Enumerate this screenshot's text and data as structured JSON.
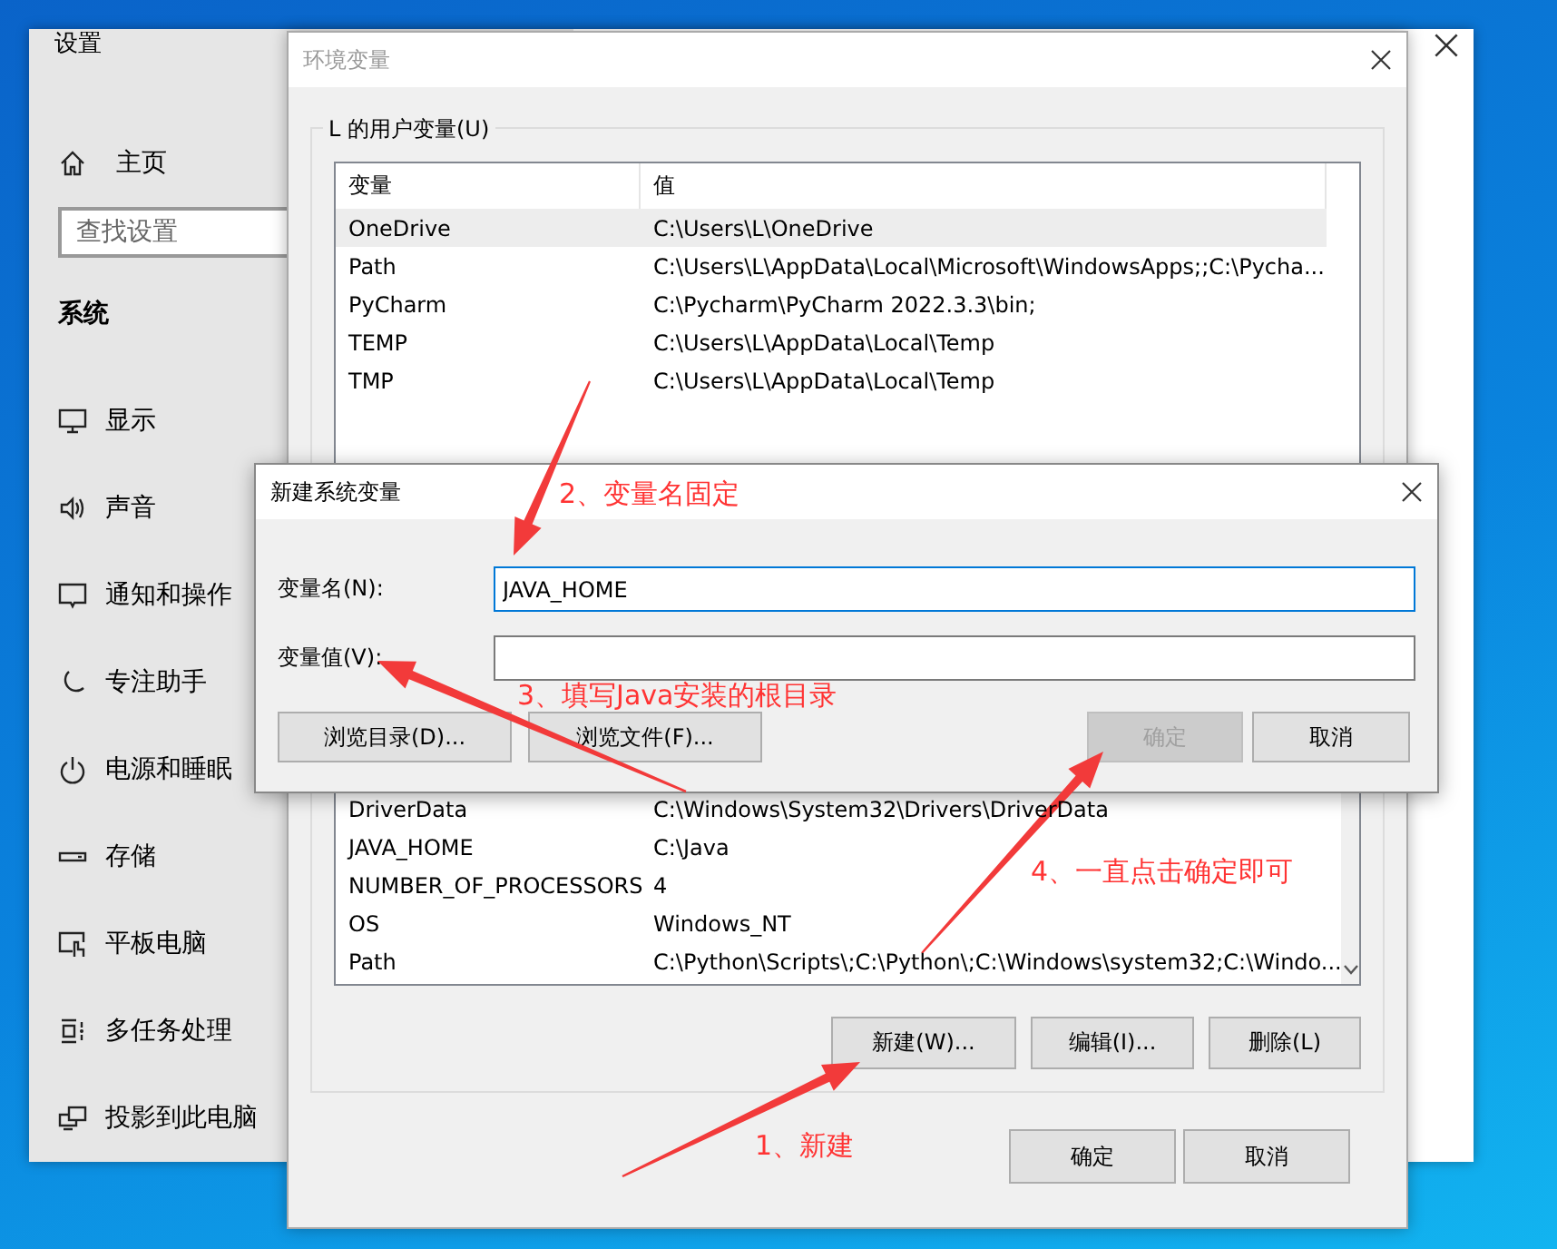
{
  "settings": {
    "title": "设置",
    "home": "主页",
    "search": {
      "placeholder": "查找设置"
    },
    "section": "系统",
    "nav": [
      {
        "label": "显示"
      },
      {
        "label": "声音"
      },
      {
        "label": "通知和操作"
      },
      {
        "label": "专注助手"
      },
      {
        "label": "电源和睡眠"
      },
      {
        "label": "存储"
      },
      {
        "label": "平板电脑"
      },
      {
        "label": "多任务处理"
      },
      {
        "label": "投影到此电脑"
      }
    ]
  },
  "env_dialog": {
    "title": "环境变量",
    "user_group": "L 的用户变量(U)",
    "user_columns": [
      "变量",
      "值"
    ],
    "user_rows": [
      {
        "name": "OneDrive",
        "value": "C:\\Users\\L\\OneDrive",
        "selected": true
      },
      {
        "name": "Path",
        "value": "C:\\Users\\L\\AppData\\Local\\Microsoft\\WindowsApps;;C:\\Pycha...",
        "selected": false
      },
      {
        "name": "PyCharm",
        "value": "C:\\Pycharm\\PyCharm 2022.3.3\\bin;",
        "selected": false
      },
      {
        "name": "TEMP",
        "value": "C:\\Users\\L\\AppData\\Local\\Temp",
        "selected": false
      },
      {
        "name": "TMP",
        "value": "C:\\Users\\L\\AppData\\Local\\Temp",
        "selected": false
      }
    ],
    "system_rows": [
      {
        "name": "DriverData",
        "value": "C:\\Windows\\System32\\Drivers\\DriverData",
        "selected": false
      },
      {
        "name": "JAVA_HOME",
        "value": "C:\\Java",
        "selected": false
      },
      {
        "name": "NUMBER_OF_PROCESSORS",
        "value": "4",
        "selected": false
      },
      {
        "name": "OS",
        "value": "Windows_NT",
        "selected": false
      },
      {
        "name": "Path",
        "value": "C:\\Python\\Scripts\\;C:\\Python\\;C:\\Windows\\system32;C:\\Windo...",
        "selected": false
      }
    ],
    "system_buttons": [
      "新建(W)...",
      "编辑(I)...",
      "删除(L)"
    ],
    "buttons": [
      "确定",
      "取消"
    ]
  },
  "new_dialog": {
    "title": "新建系统变量",
    "fields": [
      {
        "label": "变量名(N):",
        "value": "JAVA_HOME",
        "focused": true
      },
      {
        "label": "变量值(V):",
        "focused": false
      }
    ],
    "browse_buttons": [
      {
        "label": "浏览目录(D)...",
        "disabled": false
      },
      {
        "label": "浏览文件(F)...",
        "disabled": false
      }
    ],
    "buttons": [
      {
        "label": "确定",
        "disabled": true
      },
      {
        "label": "取消",
        "disabled": false
      }
    ]
  },
  "annotations": [
    {
      "text": "2、变量名固定"
    },
    {
      "text": "3、填写Java安装的根目录"
    },
    {
      "text": "4、一直点击确定即可"
    },
    {
      "text": "1、新建"
    }
  ]
}
